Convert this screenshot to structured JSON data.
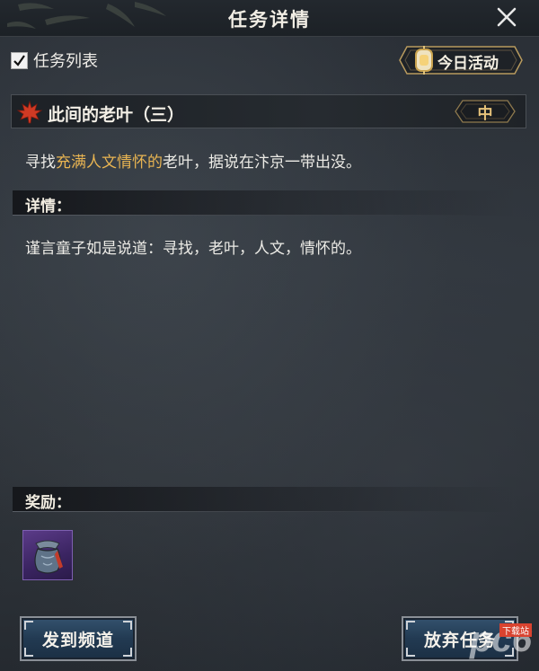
{
  "window": {
    "title": "任务详情"
  },
  "task_list_toggle": {
    "label": "任务列表",
    "checked": true
  },
  "activity_button": {
    "label": "今日活动"
  },
  "quest": {
    "name": "此间的老叶（三）",
    "difficulty": "中",
    "description_before": "寻找",
    "description_highlight": "充满人文情怀的",
    "description_after": "老叶，据说在汴京一带出没。",
    "highlight_color": "#e8b452"
  },
  "details": {
    "heading": "详情：",
    "text": "谨言童子如是说道：寻找，老叶，人文，情怀的。"
  },
  "rewards": {
    "heading": "奖励：",
    "items": [
      {
        "icon": "pouch-icon"
      }
    ]
  },
  "buttons": {
    "send": "发到频道",
    "abandon": "放弃任务"
  },
  "watermark": {
    "brand": "pc6",
    "tag": "下载站"
  }
}
